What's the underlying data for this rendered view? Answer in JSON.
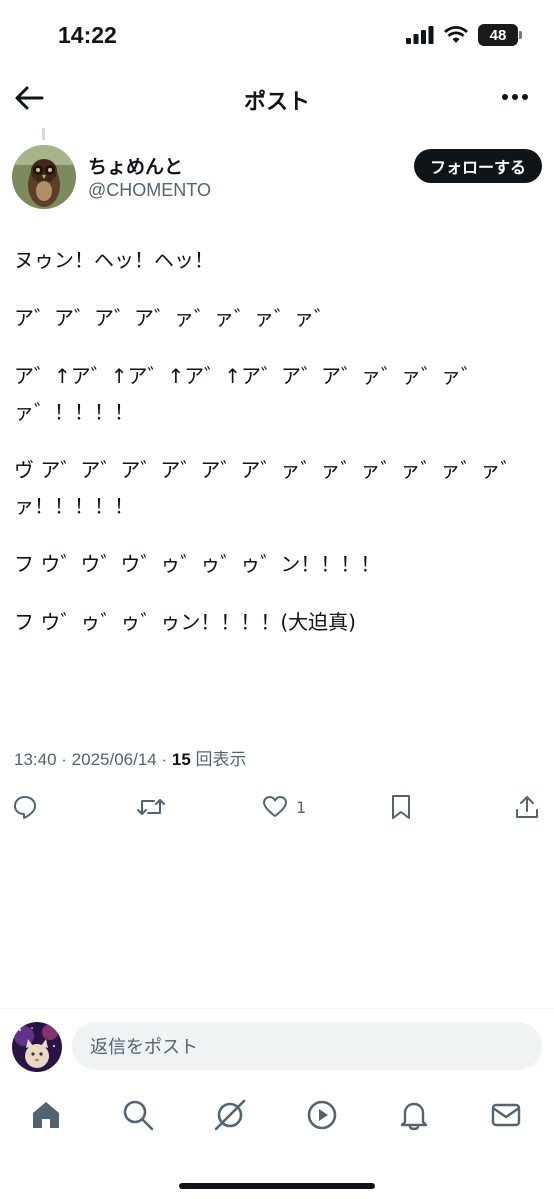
{
  "status_bar": {
    "time": "14:22",
    "battery": "48"
  },
  "header": {
    "title": "ポスト"
  },
  "author": {
    "display_name": "ちょめんと",
    "handle": "@CHOMENTO",
    "follow_label": "フォローする"
  },
  "post": {
    "paragraphs": [
      "ヌゥン！ヘッ！ヘッ！",
      "ア゛ア゛ア゛ア゛ァ゛ァ゛ァ゛ァ゛",
      "ア゛↑ア゛↑ア゛↑ア゛↑ア゛ア゛ア゛ァ゛ァ゛ァ゛ァ゛！！！！",
      "ヴ ア゛ア゛ア゛ア゛ア゛ア゛ァ゛ァ゛ァ゛ァ゛ァ゛ァ゛ァ！！！！！",
      "フ ウ゛ウ゛ウ゛ゥ゛ゥ゛ゥ゛ン！！！！",
      "フ ウ゛ゥ゛ゥ゛ゥン！！！！(大迫真)"
    ]
  },
  "meta": {
    "time": "13:40",
    "date": "2025/06/14",
    "views_count": "15",
    "views_label": "回表示"
  },
  "actions": {
    "likes": "1"
  },
  "reply": {
    "placeholder": "返信をポスト"
  },
  "colors": {
    "text": "#0f1419",
    "secondary": "#536471",
    "input_bg": "#eff3f4"
  }
}
